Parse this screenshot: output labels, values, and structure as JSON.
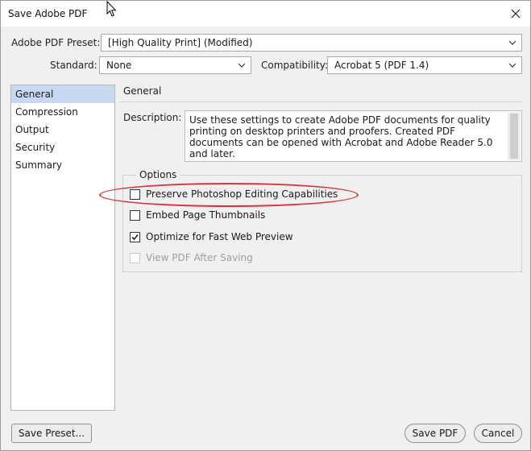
{
  "window": {
    "title": "Save Adobe PDF"
  },
  "preset": {
    "label": "Adobe PDF Preset:",
    "value": "[High Quality Print] (Modified)"
  },
  "standard": {
    "label": "Standard:",
    "value": "None"
  },
  "compatibility": {
    "label": "Compatibility:",
    "value": "Acrobat 5 (PDF 1.4)"
  },
  "sidebar": {
    "items": [
      {
        "label": "General",
        "selected": true
      },
      {
        "label": "Compression",
        "selected": false
      },
      {
        "label": "Output",
        "selected": false
      },
      {
        "label": "Security",
        "selected": false
      },
      {
        "label": "Summary",
        "selected": false
      }
    ]
  },
  "general": {
    "section_title": "General",
    "description_label": "Description:",
    "description_text": "Use these settings to create Adobe PDF documents for quality printing on desktop printers and proofers.  Created PDF documents can be opened with Acrobat and Adobe Reader 5.0 and later."
  },
  "options": {
    "legend": "Options",
    "items": [
      {
        "label": "Preserve Photoshop Editing Capabilities",
        "checked": false,
        "disabled": false
      },
      {
        "label": "Embed Page Thumbnails",
        "checked": false,
        "disabled": false
      },
      {
        "label": "Optimize for Fast Web Preview",
        "checked": true,
        "disabled": false
      },
      {
        "label": "View PDF After Saving",
        "checked": false,
        "disabled": true
      }
    ]
  },
  "buttons": {
    "save_preset": "Save Preset...",
    "save_pdf": "Save PDF",
    "cancel": "Cancel"
  },
  "colors": {
    "selection": "#c6d9f0",
    "annotation": "#d8363a",
    "background": "#f0f0f0"
  },
  "icons": {
    "close": "close-icon",
    "dropdown": "chevron-down-icon",
    "checkmark": "checkmark-icon",
    "cursor": "mouse-pointer-icon"
  }
}
